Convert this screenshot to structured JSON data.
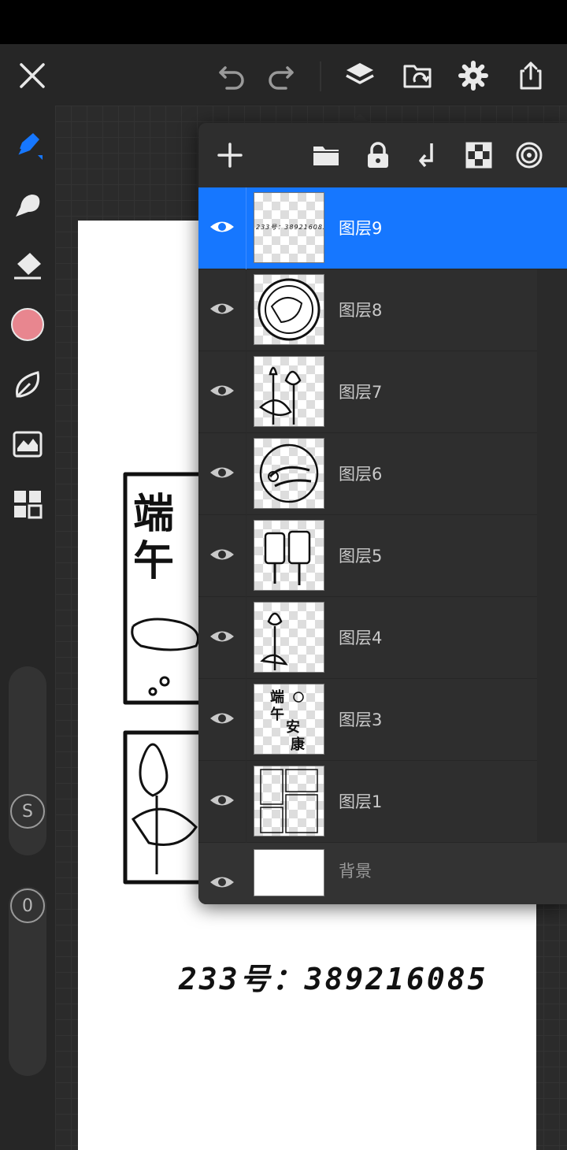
{
  "toolbar": {
    "close": "close-icon",
    "undo": "undo-icon",
    "redo": "redo-icon",
    "layers": "layers-icon",
    "gallery": "gallery-icon",
    "settings": "gear-icon",
    "share": "share-icon"
  },
  "left_tools": {
    "brush_color": "#e8868f",
    "size_badge": "S",
    "opacity_badge": "0"
  },
  "canvas": {
    "signature": "233号：389216085"
  },
  "layers_panel": {
    "tools": [
      "add-icon",
      "folder-icon",
      "lock-icon",
      "merge-down-icon",
      "transparency-icon",
      "reference-icon"
    ],
    "layers": [
      {
        "name": "图层9",
        "active": true
      },
      {
        "name": "图层8",
        "active": false
      },
      {
        "name": "图层7",
        "active": false
      },
      {
        "name": "图层6",
        "active": false
      },
      {
        "name": "图层5",
        "active": false
      },
      {
        "name": "图层4",
        "active": false
      },
      {
        "name": "图层3",
        "active": false
      },
      {
        "name": "图层1",
        "active": false
      },
      {
        "name": "背景",
        "active": false
      }
    ],
    "thumb9_text": "233号：389216085"
  },
  "colors": {
    "accent": "#1677ff",
    "panel": "#2e2e2e",
    "toolbar": "#262626"
  }
}
